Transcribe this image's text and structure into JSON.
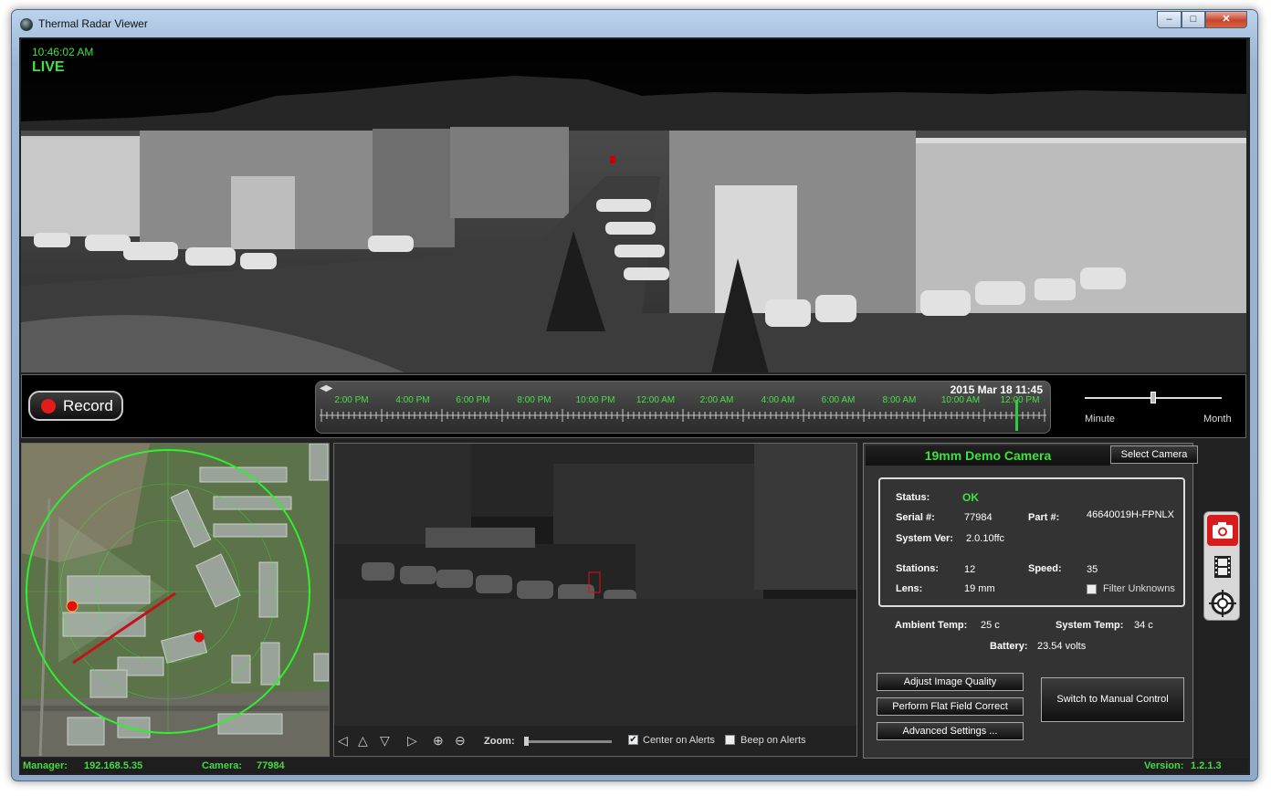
{
  "window": {
    "title": "Thermal Radar Viewer",
    "buttons": {
      "minimize": "–",
      "maximize": "□",
      "close": "✕"
    }
  },
  "main_video": {
    "time": "10:46:02 AM",
    "mode": "LIVE"
  },
  "timeline": {
    "record_label": "Record",
    "date": "2015 Mar 18 11:45",
    "hours": [
      "2:00 PM",
      "4:00 PM",
      "6:00 PM",
      "8:00 PM",
      "10:00 PM",
      "12:00 AM",
      "2:00 AM",
      "4:00 AM",
      "6:00 AM",
      "8:00 AM",
      "10:00 AM",
      "12:00 PM"
    ],
    "scale_min": "Minute",
    "scale_max": "Month"
  },
  "ptz_controls": {
    "zoom_label": "Zoom:",
    "center_on_alerts": "Center on Alerts",
    "center_checked": true,
    "beep_on_alerts": "Beep on Alerts",
    "beep_checked": false
  },
  "camera": {
    "name": "19mm Demo Camera",
    "select_label": "Select Camera",
    "status_label": "Status:",
    "status_value": "OK",
    "serial_label": "Serial #:",
    "serial_value": "77984",
    "part_label": "Part #:",
    "part_value": "46640019H-FPNLX",
    "sysver_label": "System Ver:",
    "sysver_value": "2.0.10ffc",
    "stations_label": "Stations:",
    "stations_value": "12",
    "speed_label": "Speed:",
    "speed_value": "35",
    "lens_label": "Lens:",
    "lens_value": "19 mm",
    "filter_label": "Filter Unknowns",
    "ambient_label": "Ambient Temp:",
    "ambient_value": "25 c",
    "systemp_label": "System Temp:",
    "systemp_value": "34 c",
    "battery_label": "Battery:",
    "battery_value": "23.54 volts",
    "btn_adjust": "Adjust Image Quality",
    "btn_ffc": "Perform Flat Field Correct",
    "btn_advanced": "Advanced Settings ...",
    "btn_manual": "Switch to Manual Control"
  },
  "side_toolbar": [
    "camera-icon",
    "film-icon",
    "target-icon"
  ],
  "statusbar": {
    "manager_label": "Manager:",
    "manager_value": "192.168.5.35",
    "camera_label": "Camera:",
    "camera_value": "77984",
    "version_label": "Version:",
    "version_value": "1.2.1.3"
  },
  "colors": {
    "accent_green": "#3fe23f",
    "record_red": "#e21b1b",
    "alert_red": "#e01010"
  }
}
